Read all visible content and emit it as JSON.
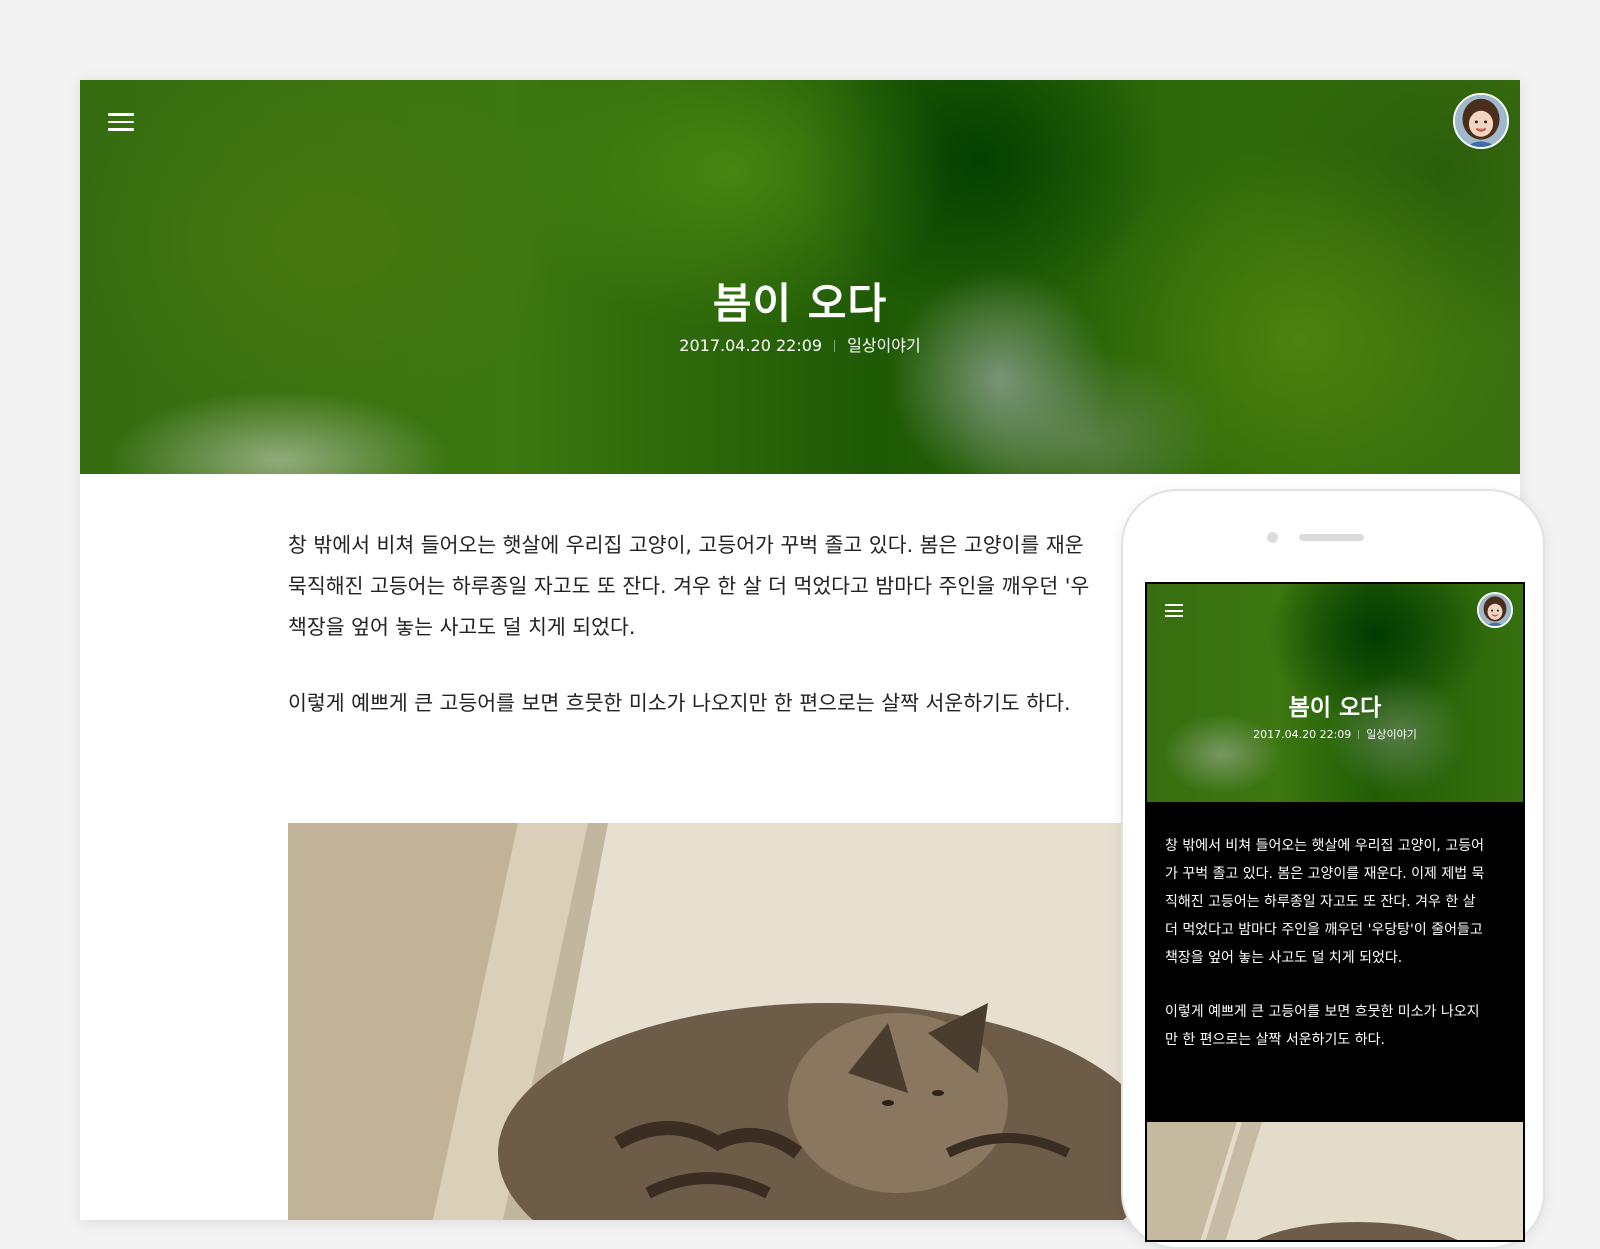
{
  "post": {
    "title": "봄이 오다",
    "date": "2017.04.20 22:09",
    "category": "일상이야기",
    "paragraphs": [
      "창 밖에서 비쳐 들어오는 햇살에 우리집 고양이, 고등어가 꾸벅 졸고 있다. 봄은 고양이를 재운",
      "묵직해진 고등어는 하루종일 자고도 또 잔다. 겨우 한 살 더 먹었다고 밤마다 주인을 깨우던 '우",
      "책장을 엎어 놓는 사고도 덜 치게 되었다.",
      "이렇게 예쁘게 큰 고등어를 보면 흐뭇한 미소가 나오지만 한 편으로는 살짝 서운하기도 하다."
    ]
  },
  "mobile": {
    "title": "봄이 오다",
    "date": "2017.04.20 22:09",
    "category": "일상이야기",
    "lines": [
      "창 밖에서 비쳐 들어오는 햇살에 우리집 고양이, 고등어",
      "가 꾸벅 졸고 있다. 봄은 고양이를 재운다. 이제 제법 묵",
      "직해진 고등어는 하루종일 자고도 또 잔다. 겨우 한 살",
      "더 먹었다고 밤마다 주인을 깨우던 '우당탕'이 줄어들고",
      "책장을 엎어 놓는 사고도 덜 치게 되었다.",
      "이렇게 예쁘게 큰 고등어를 보면 흐뭇한 미소가 나오지",
      "만 한 편으로는 살짝 서운하기도 하다."
    ]
  },
  "icons": {
    "menu": "hamburger-menu-icon",
    "avatar": "profile-avatar"
  },
  "colors": {
    "background": "#f3f3f3",
    "hero_green": "#3c7710",
    "mobile_body_bg": "#000000",
    "text": "#222222"
  }
}
